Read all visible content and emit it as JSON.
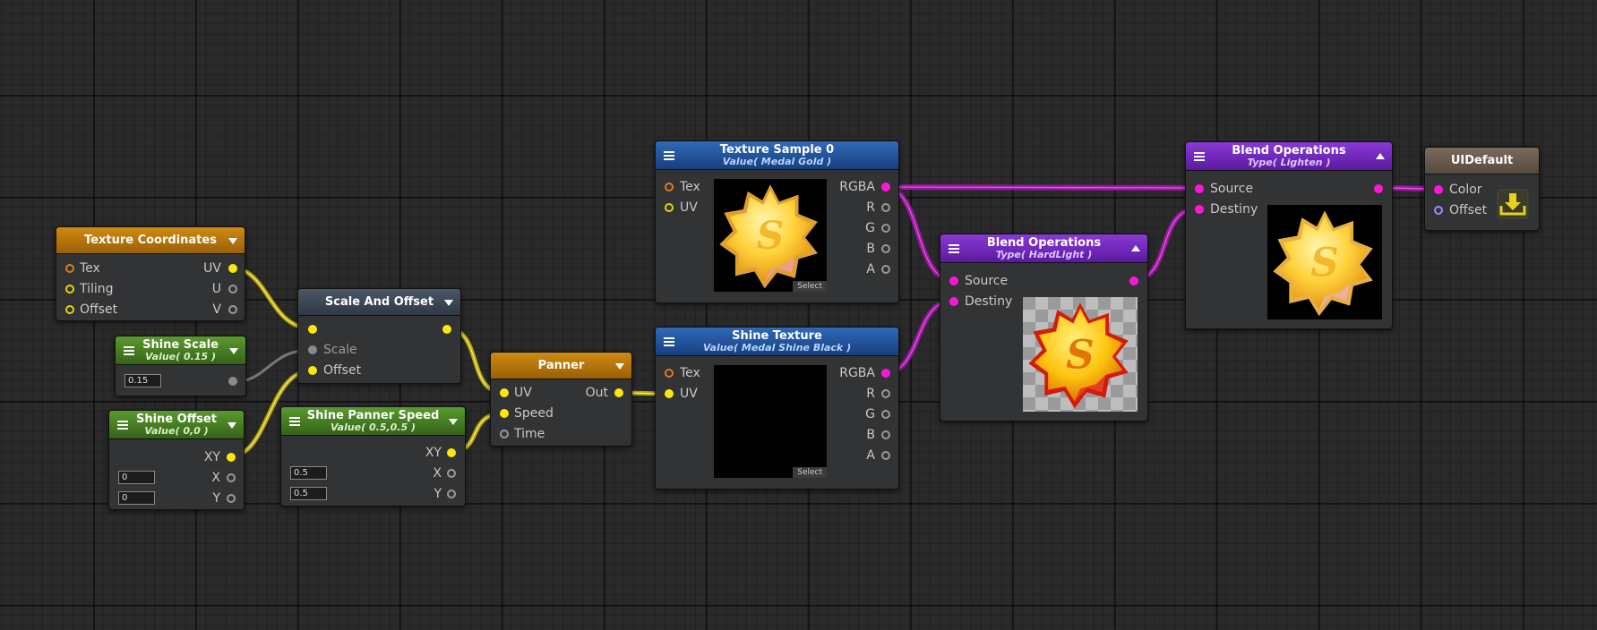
{
  "colors": {
    "vector_port": "#ffe60a",
    "color_port": "#ff17d9",
    "float_port": "#8a8a8a",
    "sampler_port": "#e07a20",
    "header_orange": "#cf8a10",
    "header_green": "#5a9a2e",
    "header_blue": "#2f6ab8",
    "header_purple": "#8a3ad6",
    "header_slate": "#4a5766",
    "header_tan": "#7a6a5a"
  },
  "nodes": {
    "texture_coordinates": {
      "title": "Texture Coordinates",
      "inputs": [
        "Tex",
        "Tiling",
        "Offset"
      ],
      "outputs": [
        "UV",
        "U",
        "V"
      ]
    },
    "shine_scale": {
      "title": "Shine Scale",
      "subtitle": "Value( 0.15 )",
      "value": "0.15"
    },
    "shine_offset": {
      "title": "Shine Offset",
      "subtitle": "Value( 0,0 )",
      "outputs": [
        "XY",
        "X",
        "Y"
      ],
      "x_value": "0",
      "y_value": "0"
    },
    "scale_and_offset": {
      "title": "Scale And Offset",
      "inputs": [
        "Scale",
        "Offset"
      ]
    },
    "shine_panner_speed": {
      "title": "Shine Panner Speed",
      "subtitle": "Value( 0.5,0.5 )",
      "outputs": [
        "XY",
        "X",
        "Y"
      ],
      "x_value": "0.5",
      "y_value": "0.5"
    },
    "panner": {
      "title": "Panner",
      "inputs": [
        "UV",
        "Speed",
        "Time"
      ],
      "output": "Out"
    },
    "texture_sample_0": {
      "title": "Texture Sample 0",
      "subtitle": "Value( Medal Gold )",
      "inputs": [
        "Tex",
        "UV"
      ],
      "outputs": [
        "RGBA",
        "R",
        "G",
        "B",
        "A"
      ],
      "select_label": "Select"
    },
    "shine_texture": {
      "title": "Shine Texture",
      "subtitle": "Value( Medal Shine Black )",
      "inputs": [
        "Tex",
        "UV"
      ],
      "outputs": [
        "RGBA",
        "R",
        "G",
        "B",
        "A"
      ],
      "select_label": "Select"
    },
    "blend_hardlight": {
      "title": "Blend Operations",
      "subtitle": "Type( HardLight )",
      "inputs": [
        "Source",
        "Destiny"
      ]
    },
    "blend_lighten": {
      "title": "Blend Operations",
      "subtitle": "Type( Lighten )",
      "inputs": [
        "Source",
        "Destiny"
      ]
    },
    "ui_default": {
      "title": "UIDefault",
      "inputs": [
        "Color",
        "Offset"
      ]
    }
  },
  "icons": {
    "menu": "hamburger-menu-icon",
    "dropdown": "triangle-down-icon",
    "collapse": "triangle-up-icon",
    "output": "download-tray-icon"
  }
}
